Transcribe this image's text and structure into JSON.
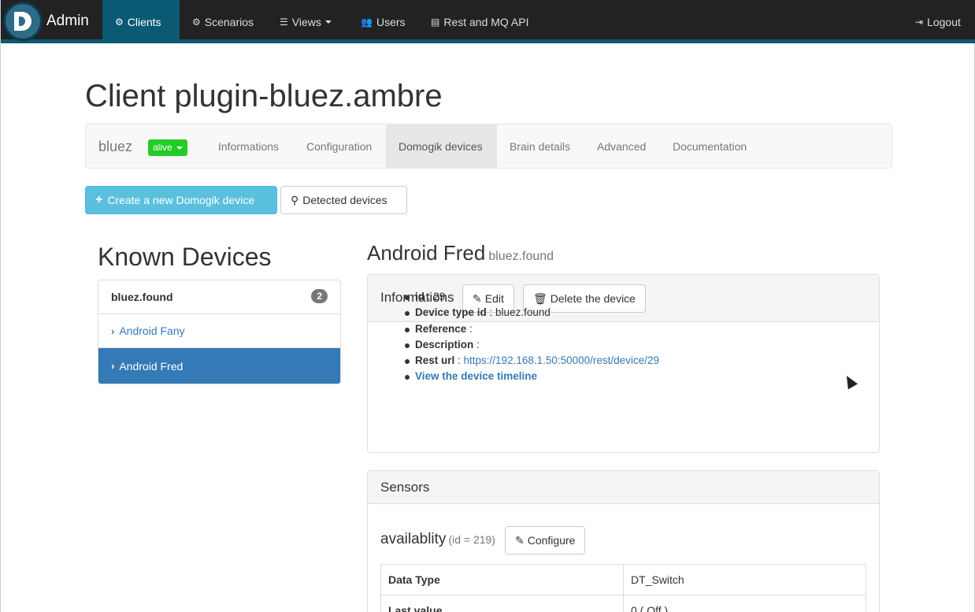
{
  "navbar": {
    "brand": "Admin",
    "items": [
      {
        "label": "Clients",
        "icon": "cogs-icon"
      },
      {
        "label": "Scenarios",
        "icon": "gear-icon"
      },
      {
        "label": "Views",
        "icon": "list-icon"
      },
      {
        "label": "Users",
        "icon": "users-icon"
      },
      {
        "label": "Rest and MQ API",
        "icon": "book-icon"
      }
    ],
    "logout": "Logout"
  },
  "page": {
    "title": "Client plugin-bluez.ambre"
  },
  "subnav": {
    "name": "bluez",
    "status": "alive",
    "status_color": "#22cc22",
    "tabs": [
      "Informations",
      "Configuration",
      "Domogik devices",
      "Brain details",
      "Advanced",
      "Documentation"
    ],
    "active_tab": "Domogik devices"
  },
  "actions": {
    "create": "Create a new Domogik device",
    "detected": "Detected devices"
  },
  "known_devices": {
    "title": "Known Devices",
    "group": "bluez.found",
    "count": "2",
    "items": [
      "Android Fany",
      "Android Fred"
    ],
    "selected": "Android Fred"
  },
  "device": {
    "name": "Android Fred",
    "type": "bluez.found",
    "info_panel": {
      "title": "Informations",
      "edit": "Edit",
      "delete": "Delete the device",
      "fields": [
        {
          "key": "id",
          "value": " : 29"
        },
        {
          "key": "Device type id",
          "value": " : bluez.found"
        },
        {
          "key": "Reference",
          "value": " :"
        },
        {
          "key": "Description",
          "value": " :"
        },
        {
          "key": "Rest url",
          "value": " : ",
          "link": "https://192.168.1.50:50000/rest/device/29"
        }
      ],
      "timeline_link": "View the device timeline"
    },
    "sensors": {
      "title": "Sensors",
      "sensor_name": "availablity",
      "sensor_id": "(id = 219)",
      "configure": "Configure",
      "rows": [
        {
          "key": "Data Type",
          "value": "DT_Switch"
        },
        {
          "key": "Last value",
          "value": "0 ( Off )"
        }
      ]
    }
  }
}
